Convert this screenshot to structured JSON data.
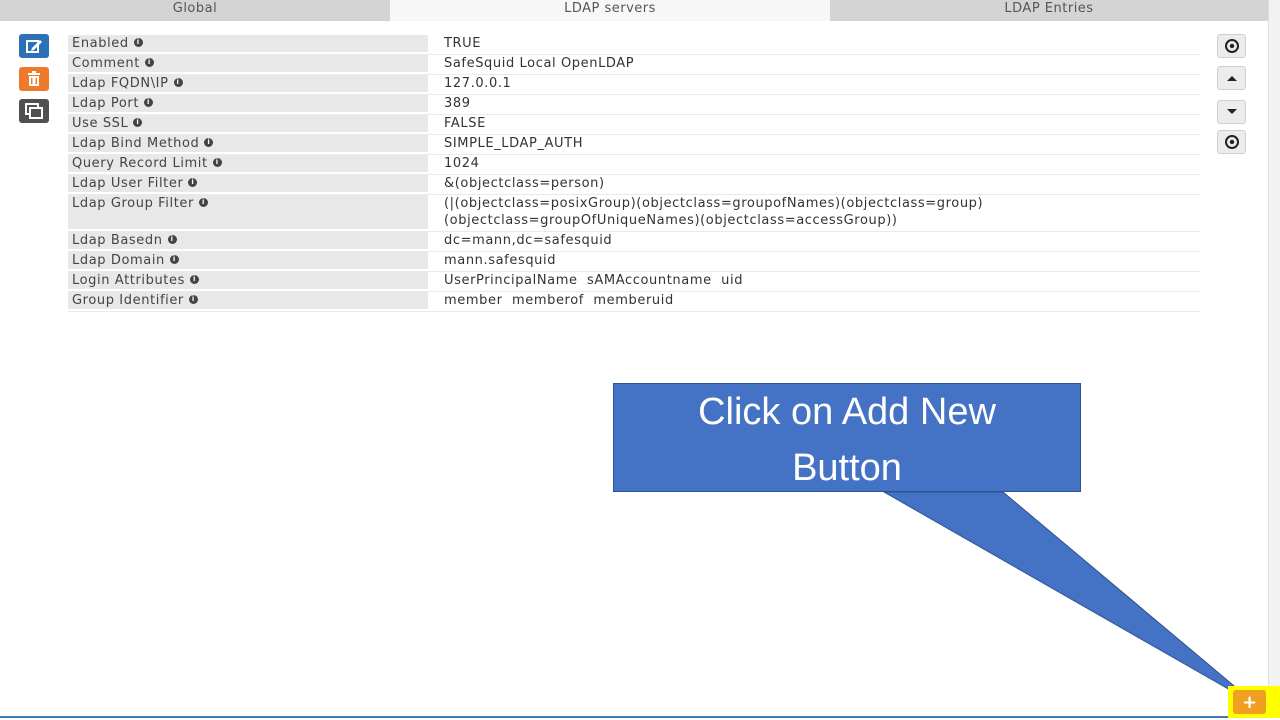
{
  "tabs": [
    {
      "label": "Global",
      "active": false
    },
    {
      "label": "LDAP servers",
      "active": true
    },
    {
      "label": "LDAP Entries",
      "active": false
    }
  ],
  "actions": {
    "edit_icon": "edit-icon",
    "delete_icon": "trash-icon",
    "copy_icon": "copy-icon",
    "colors": {
      "edit": "#2a72b5",
      "delete": "#f07a2c",
      "copy": "#505050"
    }
  },
  "fields": [
    {
      "label": "Enabled",
      "value": "TRUE"
    },
    {
      "label": "Comment",
      "value": "SafeSquid Local OpenLDAP"
    },
    {
      "label": "Ldap FQDN\\IP",
      "value": "127.0.0.1"
    },
    {
      "label": "Ldap Port",
      "value": "389"
    },
    {
      "label": "Use SSL",
      "value": "FALSE"
    },
    {
      "label": "Ldap Bind Method",
      "value": "SIMPLE_LDAP_AUTH"
    },
    {
      "label": "Query Record Limit",
      "value": "1024"
    },
    {
      "label": "Ldap User Filter",
      "value": "&(objectclass=person)"
    },
    {
      "label": "Ldap Group Filter",
      "value": "(|(objectclass=posixGroup)(objectclass=groupofNames)(objectclass=group)",
      "value2": "(objectclass=groupOfUniqueNames)(objectclass=accessGroup))"
    },
    {
      "label": "Ldap Basedn",
      "value": "dc=mann,dc=safesquid"
    },
    {
      "label": "Ldap Domain",
      "value": "mann.safesquid"
    },
    {
      "label": "Login Attributes",
      "value": "UserPrincipalName  sAMAccountname  uid"
    },
    {
      "label": "Group Identifier",
      "value": "member  memberof  memberuid"
    }
  ],
  "side_buttons": [
    "eye-icon",
    "caret-up-icon",
    "caret-down-icon",
    "eye-icon"
  ],
  "callout": {
    "line1": "Click on Add New",
    "line2": "Button",
    "color": "#4472c4"
  },
  "add_button": {
    "icon": "plus-icon",
    "color": "#f0a020",
    "highlight": "#ffff00"
  }
}
